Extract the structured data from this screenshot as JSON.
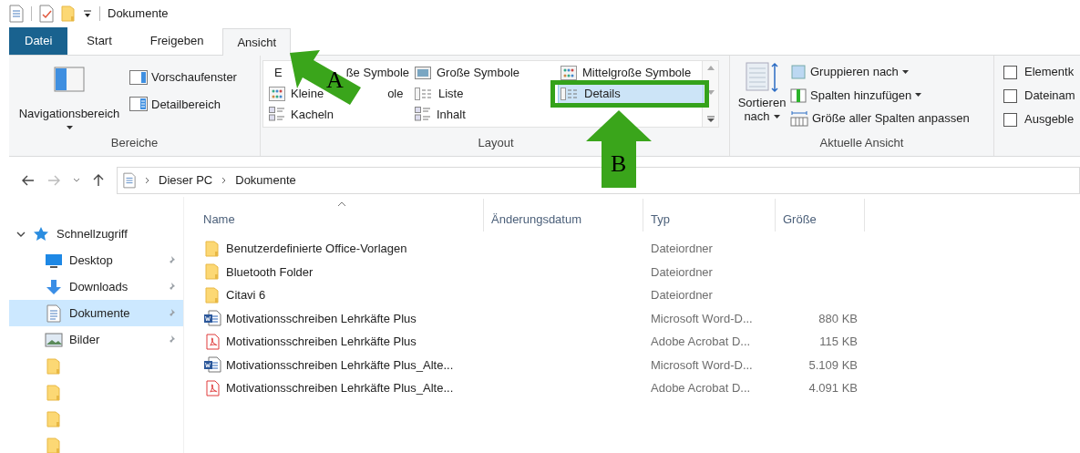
{
  "window": {
    "title": "Dokumente"
  },
  "tabs": [
    {
      "label": "Datei",
      "kind": "file",
      "selected": false
    },
    {
      "label": "Start",
      "kind": "tab",
      "selected": false
    },
    {
      "label": "Freigeben",
      "kind": "tab",
      "selected": false
    },
    {
      "label": "Ansicht",
      "kind": "tab",
      "selected": true
    }
  ],
  "ribbon": {
    "panes": {
      "group": "Bereiche",
      "nav": "Navigationsbereich",
      "preview": "Vorschaufenster",
      "details": "Detailbereich"
    },
    "layout": {
      "group": "Layout",
      "items": [
        {
          "label_parts": [
            "E",
            "ße Symbole"
          ],
          "kind": "xl",
          "selected": false
        },
        {
          "label_parts": [
            "Große Symbole"
          ],
          "kind": "large",
          "selected": false
        },
        {
          "label_parts": [
            "Mittelgroße Symbole"
          ],
          "kind": "medium",
          "selected": false
        },
        {
          "label_parts": [
            "Kleine",
            "ole"
          ],
          "kind": "small",
          "selected": false
        },
        {
          "label_parts": [
            "Liste"
          ],
          "kind": "list",
          "selected": false
        },
        {
          "label_parts": [
            "Details"
          ],
          "kind": "details",
          "selected": true
        },
        {
          "label_parts": [
            "Kacheln"
          ],
          "kind": "tiles",
          "selected": false
        },
        {
          "label_parts": [
            "Inhalt"
          ],
          "kind": "content",
          "selected": false
        }
      ]
    },
    "current_view": {
      "group": "Aktuelle Ansicht",
      "sort_lines": [
        "Sortieren",
        "nach"
      ],
      "group_by": "Gruppieren nach",
      "add_columns": "Spalten hinzufügen",
      "fit_columns": "Größe aller Spalten anpassen"
    },
    "show_hide": [
      {
        "label": "Elementk",
        "checked": false
      },
      {
        "label": "Dateinam",
        "checked": false
      },
      {
        "label": "Ausgeble",
        "checked": false
      }
    ]
  },
  "address": {
    "crumbs": [
      "Dieser PC",
      "Dokumente"
    ]
  },
  "nav_pane": [
    {
      "label": "Schnellzugriff",
      "expanded": true,
      "children": [
        {
          "kind": "desktop",
          "label": "Desktop",
          "pinned": true,
          "selected": false
        },
        {
          "kind": "downloads",
          "label": "Downloads",
          "pinned": true,
          "selected": false
        },
        {
          "kind": "documents",
          "label": "Dokumente",
          "pinned": true,
          "selected": true
        },
        {
          "kind": "pictures",
          "label": "Bilder",
          "pinned": true,
          "selected": false
        },
        {
          "kind": "folder",
          "pinned": false,
          "selected": false
        },
        {
          "kind": "folder",
          "pinned": false,
          "selected": false
        },
        {
          "kind": "folder",
          "pinned": false,
          "selected": false
        },
        {
          "kind": "folder",
          "pinned": false,
          "selected": false
        }
      ]
    }
  ],
  "table": {
    "columns": [
      "Name",
      "Änderungsdatum",
      "Typ",
      "Größe"
    ],
    "rows": [
      {
        "kind": "folder",
        "name": "Benutzerdefinierte Office-Vorlagen",
        "type": "Dateiordner"
      },
      {
        "kind": "folder",
        "name": "Bluetooth Folder",
        "type": "Dateiordner"
      },
      {
        "kind": "folder",
        "name": "Citavi 6",
        "type": "Dateiordner"
      },
      {
        "kind": "word",
        "name": "Motivationsschreiben Lehrkäfte Plus",
        "type": "Microsoft Word-D...",
        "size": "880 KB"
      },
      {
        "kind": "pdf",
        "name": "Motivationsschreiben Lehrkäfte Plus",
        "type": "Adobe Acrobat D...",
        "size": "115 KB"
      },
      {
        "kind": "word",
        "name": "Motivationsschreiben Lehrkäfte Plus_Alte...",
        "type": "Microsoft Word-D...",
        "size": "5.109 KB"
      },
      {
        "kind": "pdf",
        "name": "Motivationsschreiben Lehrkäfte Plus_Alte...",
        "type": "Adobe Acrobat D...",
        "size": "4.091 KB"
      }
    ]
  },
  "annotations": [
    {
      "letter": "A"
    },
    {
      "letter": "B"
    }
  ]
}
